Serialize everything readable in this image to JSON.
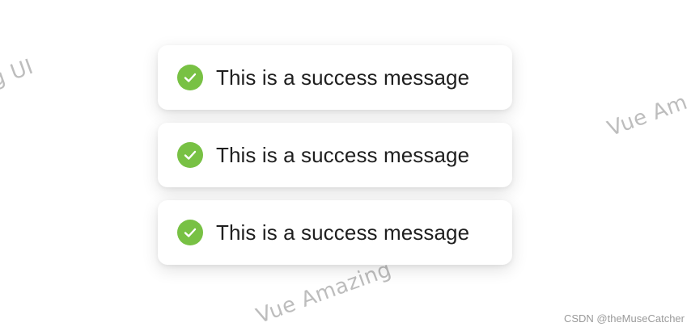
{
  "watermark": {
    "text_left": "azing UI",
    "text_right": "Vue Am",
    "text_bottom": "Vue Amazing"
  },
  "messages": [
    {
      "text": "This is a success message",
      "icon": "check-circle-icon",
      "type": "success"
    },
    {
      "text": "This is a success message",
      "icon": "check-circle-icon",
      "type": "success"
    },
    {
      "text": "This is a success message",
      "icon": "check-circle-icon",
      "type": "success"
    }
  ],
  "colors": {
    "success": "#78c144",
    "text": "#1f1f1f",
    "watermark": "#bdbdbd"
  },
  "footer": {
    "credit": "CSDN @theMuseCatcher"
  }
}
